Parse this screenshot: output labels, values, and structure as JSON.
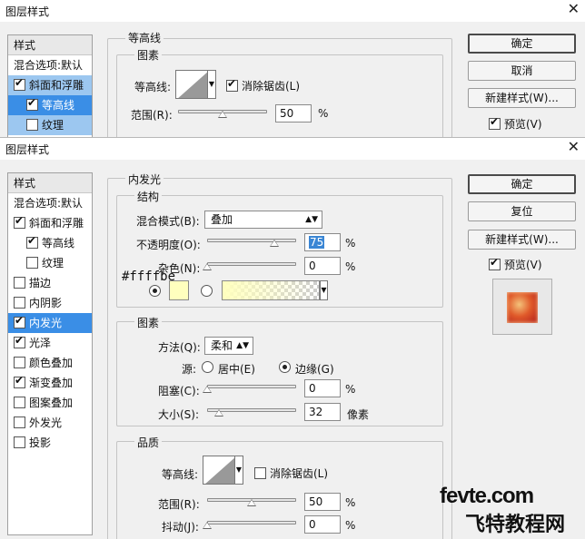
{
  "dialog1": {
    "title": "图层样式",
    "close": "✕",
    "sidebar": {
      "header": "样式",
      "items": [
        {
          "label": "混合选项:默认",
          "checkbox": false,
          "checked": false
        },
        {
          "label": "斜面和浮雕",
          "checkbox": true,
          "checked": true
        },
        {
          "label": "等高线",
          "checkbox": true,
          "checked": true
        },
        {
          "label": "纹理",
          "checkbox": true,
          "checked": false
        }
      ]
    },
    "section_title": "等高线",
    "group_title": "图素",
    "contour_label": "等高线:",
    "antialias_label": "消除锯齿(L)",
    "antialias_checked": true,
    "range_label": "范围(R):",
    "range_value": "50",
    "range_unit": "%",
    "range_fraction": 0.5,
    "buttons": {
      "ok": "确定",
      "cancel": "取消",
      "new_style": "新建样式(W)...",
      "preview": "预览(V)"
    },
    "preview_checked": true
  },
  "dialog2": {
    "title": "图层样式",
    "close": "✕",
    "sidebar": {
      "header": "样式",
      "items": [
        {
          "label": "混合选项:默认",
          "checkbox": false,
          "checked": false
        },
        {
          "label": "斜面和浮雕",
          "checkbox": true,
          "checked": true
        },
        {
          "label": "等高线",
          "checkbox": true,
          "checked": true
        },
        {
          "label": "纹理",
          "checkbox": true,
          "checked": false
        },
        {
          "label": "描边",
          "checkbox": true,
          "checked": false
        },
        {
          "label": "内阴影",
          "checkbox": true,
          "checked": false
        },
        {
          "label": "内发光",
          "checkbox": true,
          "checked": true
        },
        {
          "label": "光泽",
          "checkbox": true,
          "checked": true
        },
        {
          "label": "颜色叠加",
          "checkbox": true,
          "checked": false
        },
        {
          "label": "渐变叠加",
          "checkbox": true,
          "checked": true
        },
        {
          "label": "图案叠加",
          "checkbox": true,
          "checked": false
        },
        {
          "label": "外发光",
          "checkbox": true,
          "checked": false
        },
        {
          "label": "投影",
          "checkbox": true,
          "checked": false
        }
      ]
    },
    "section_title": "内发光",
    "structure": {
      "title": "结构",
      "blend_mode_label": "混合模式(B):",
      "blend_mode_value": "叠加",
      "opacity_label": "不透明度(O):",
      "opacity_value": "75",
      "opacity_fraction": 0.75,
      "noise_label": "杂色(N):",
      "noise_value": "0",
      "noise_fraction": 0,
      "unit": "%",
      "color_hex_note": "#ffffbe",
      "glow_color": "#ffffbe"
    },
    "elements": {
      "title": "图素",
      "method_label": "方法(Q):",
      "method_value": "柔和",
      "source_label": "源:",
      "source_center": "居中(E)",
      "source_edge": "边缘(G)",
      "choke_label": "阻塞(C):",
      "choke_value": "0",
      "choke_fraction": 0,
      "size_label": "大小(S):",
      "size_value": "32",
      "size_fraction": 0.13,
      "size_unit": "像素",
      "unit": "%"
    },
    "quality": {
      "title": "品质",
      "contour_label": "等高线:",
      "antialias_label": "消除锯齿(L)",
      "antialias_checked": false,
      "range_label": "范围(R):",
      "range_value": "50",
      "range_fraction": 0.5,
      "jitter_label": "抖动(J):",
      "jitter_value": "0",
      "jitter_fraction": 0,
      "unit": "%"
    },
    "buttons": {
      "ok": "确定",
      "reset": "复位",
      "new_style": "新建样式(W)...",
      "preview": "预览(V)"
    },
    "preview_checked": true
  },
  "watermark": {
    "line1": "fevte.com",
    "line2": "飞特教程网"
  }
}
